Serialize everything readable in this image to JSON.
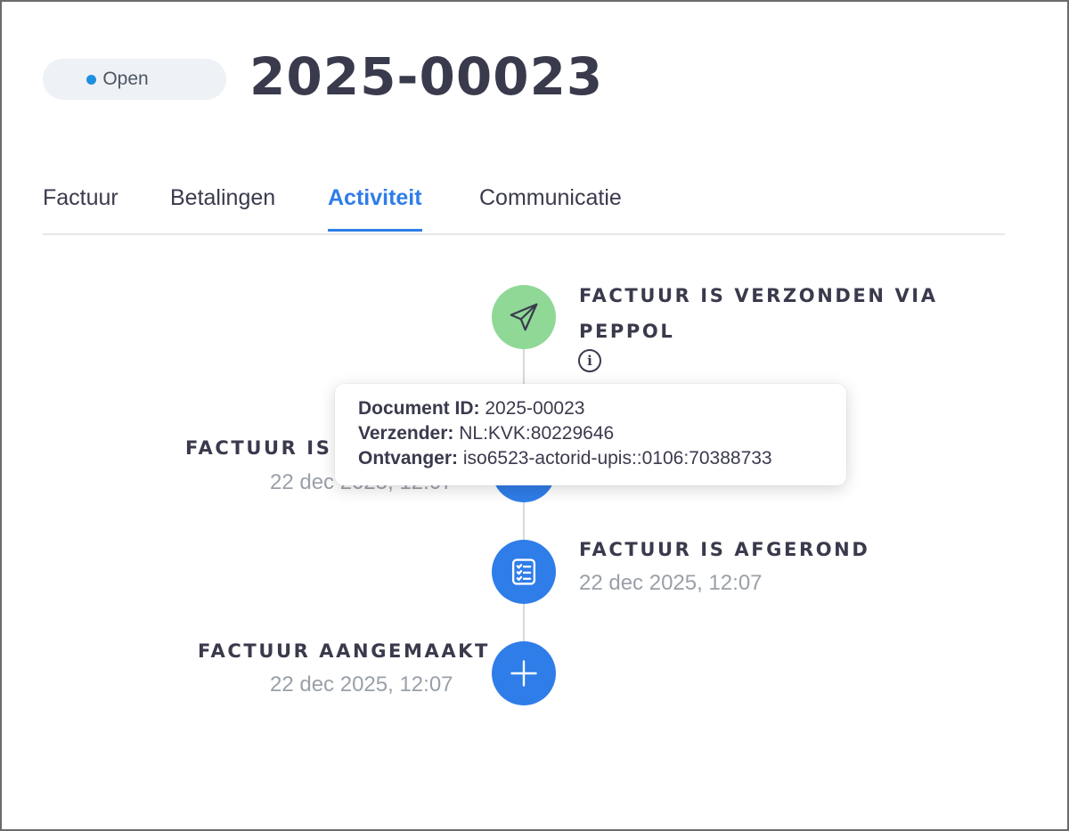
{
  "header": {
    "status": "Open",
    "status_color": "#1f8fe0",
    "title": "2025-00023"
  },
  "tabs": [
    {
      "label": "Factuur",
      "active": false
    },
    {
      "label": "Betalingen",
      "active": false
    },
    {
      "label": "Activiteit",
      "active": true
    },
    {
      "label": "Communicatie",
      "active": false
    }
  ],
  "colors": {
    "accent": "#2f7de8",
    "success": "#8fd896"
  },
  "timeline": [
    {
      "title_line1": "FACTUUR IS VERZONDEN VIA",
      "title_line2": "PEPPOL",
      "icon": "paper-plane-icon",
      "side": "right"
    },
    {
      "title": "FACTUUR IS V",
      "date": "22 dec 2025, 12:07",
      "icon": "document-icon",
      "side": "left"
    },
    {
      "title": "FACTUUR IS AFGEROND",
      "date": "22 dec 2025, 12:07",
      "icon": "checklist-icon",
      "side": "right"
    },
    {
      "title": "FACTUUR AANGEMAAKT",
      "date": "22 dec 2025, 12:07",
      "icon": "plus-icon",
      "side": "left"
    }
  ],
  "tooltip": {
    "document_id_label": "Document ID:",
    "document_id": "2025-00023",
    "sender_label": "Verzender:",
    "sender": "NL:KVK:80229646",
    "receiver_label": "Ontvanger:",
    "receiver": "iso6523-actorid-upis::0106:70388733"
  }
}
